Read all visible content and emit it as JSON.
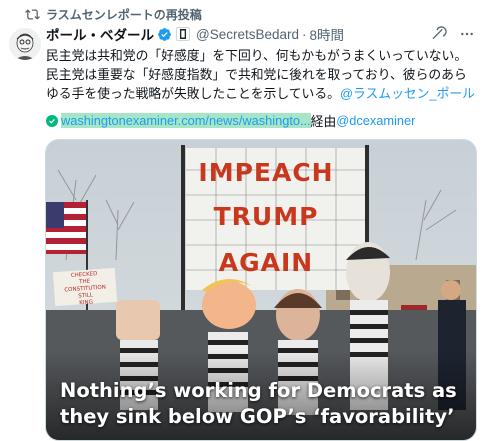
{
  "repost": {
    "icon": "repost-icon",
    "label": "ラスムセンレポートの再投稿"
  },
  "author": {
    "name": "ポール・ベダール",
    "handle": "@SecretsBedard",
    "time": "8時間",
    "verified_color": "#1d9bf0"
  },
  "tweet": {
    "text": "民主党は共和党の「好感度」を下回り、何もかもがうまくいっていない。民主党は重要な「好感度指数」で共和党に後れを取っており、彼らのあらゆる手を使った戦略が失敗したことを示している。",
    "mention": "@ラスムッセン_ポール",
    "link_url": "washingtonexaminer.com/news/washingto...",
    "via_label": "経由",
    "via_handle": "@dcexaminer"
  },
  "media": {
    "sign_lines": [
      "IMPEACH",
      "TRUMP",
      "AGAIN"
    ],
    "picket_lines": [
      "CHECKED",
      "THE",
      "CONSTITUTION",
      "STILL",
      "KING"
    ],
    "headline": "Nothing’s working for Democrats as they sink below GOP’s ‘favorability’"
  },
  "colors": {
    "link": "#1d9bf0",
    "secondary_text": "#536471",
    "link_highlight": "#a6e6c7",
    "sign_red": "#c9381d"
  }
}
